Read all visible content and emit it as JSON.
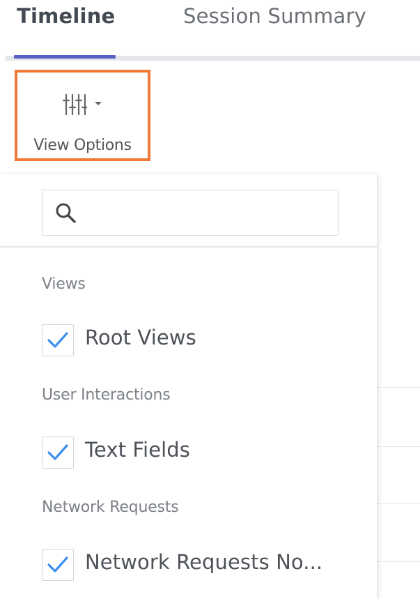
{
  "tabs": [
    {
      "label": "Timeline",
      "active": true
    },
    {
      "label": "Session Summary",
      "active": false
    }
  ],
  "colors": {
    "active_tab_underline": "#5b5fc7",
    "highlight_border": "#f07a35",
    "checkmark": "#3d8ef0"
  },
  "view_options": {
    "icon": "sliders-icon",
    "caret_icon": "caret-down-icon",
    "label": "View Options"
  },
  "dropdown": {
    "search": {
      "icon": "search-icon",
      "value": "",
      "placeholder": ""
    },
    "sections": [
      {
        "label": "Views",
        "options": [
          {
            "label": "Root Views",
            "checked": true
          }
        ]
      },
      {
        "label": "User Interactions",
        "options": [
          {
            "label": "Text Fields",
            "checked": true
          }
        ]
      },
      {
        "label": "Network Requests",
        "options": [
          {
            "label": "Network Requests No...",
            "checked": true
          }
        ]
      }
    ]
  }
}
